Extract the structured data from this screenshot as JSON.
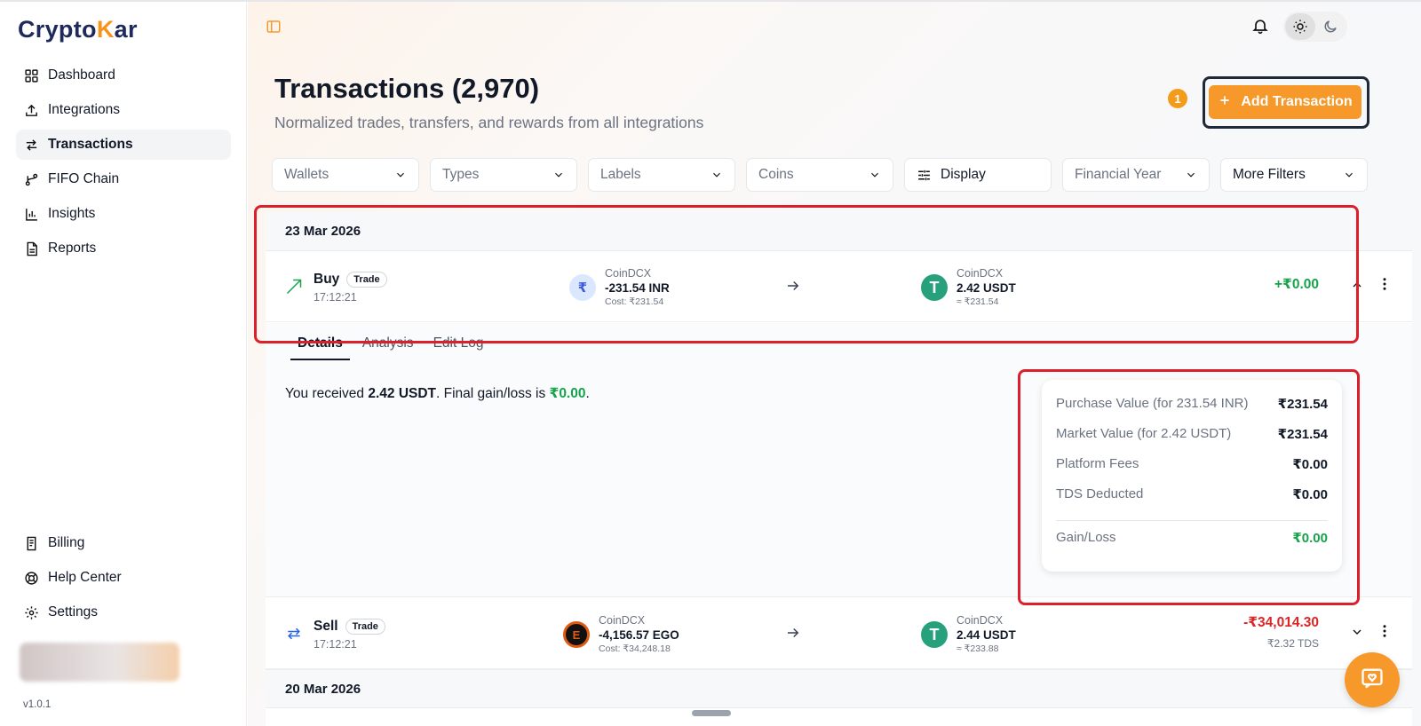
{
  "app": {
    "logo_prefix": "Crypto",
    "logo_k": "K",
    "logo_suffix": "ar",
    "version": "v1.0.1"
  },
  "sidebar": {
    "items": [
      {
        "label": "Dashboard",
        "icon": "grid-icon"
      },
      {
        "label": "Integrations",
        "icon": "upload-icon"
      },
      {
        "label": "Transactions",
        "icon": "swap-icon",
        "active": true
      },
      {
        "label": "FIFO Chain",
        "icon": "git-branch-icon"
      },
      {
        "label": "Insights",
        "icon": "bar-chart-icon"
      },
      {
        "label": "Reports",
        "icon": "document-icon"
      }
    ],
    "bottom_items": [
      {
        "label": "Billing",
        "icon": "receipt-icon"
      },
      {
        "label": "Help Center",
        "icon": "lifebuoy-icon"
      },
      {
        "label": "Settings",
        "icon": "gear-icon"
      }
    ]
  },
  "header": {
    "title": "Transactions (2,970)",
    "subtitle": "Normalized trades, transfers, and rewards from all integrations",
    "step_badge": "1",
    "add_button": "Add Transaction"
  },
  "filters": [
    {
      "label": "Wallets"
    },
    {
      "label": "Types"
    },
    {
      "label": "Labels"
    },
    {
      "label": "Coins"
    },
    {
      "label": "Display"
    },
    {
      "label": "Financial Year"
    },
    {
      "label": "More Filters"
    }
  ],
  "groups": [
    {
      "date": "23 Mar 2026",
      "transactions": [
        {
          "type": "Buy",
          "tag": "Trade",
          "time": "17:12:21",
          "from": {
            "exchange": "CoinDCX",
            "amount": "-231.54 INR",
            "sub": "Cost: ₹231.54",
            "coin_symbol": "₹"
          },
          "to": {
            "exchange": "CoinDCX",
            "amount": "2.42 USDT",
            "sub": "≈ ₹231.54",
            "coin_symbol": "T"
          },
          "gain": "+₹0.00",
          "expanded": {
            "tabs": [
              "Details",
              "Analysis",
              "Edit Log"
            ],
            "summary_prefix": "You received ",
            "summary_amount": "2.42 USDT",
            "summary_mid": ". Final gain/loss is ",
            "summary_gain": "₹0.00",
            "summary_end": ".",
            "card": [
              {
                "label": "Purchase Value (for 231.54 INR)",
                "value": "₹231.54"
              },
              {
                "label": "Market Value (for 2.42 USDT)",
                "value": "₹231.54"
              },
              {
                "label": "Platform Fees",
                "value": "₹0.00"
              },
              {
                "label": "TDS Deducted",
                "value": "₹0.00"
              }
            ],
            "gain_label": "Gain/Loss",
            "gain_value": "₹0.00"
          }
        },
        {
          "type": "Sell",
          "tag": "Trade",
          "time": "17:12:21",
          "from": {
            "exchange": "CoinDCX",
            "amount": "-4,156.57 EGO",
            "sub": "Cost: ₹34,248.18",
            "coin_symbol": "E"
          },
          "to": {
            "exchange": "CoinDCX",
            "amount": "2.44 USDT",
            "sub": "≈ ₹233.88",
            "coin_symbol": "T"
          },
          "gain": "-₹34,014.30",
          "gain_sub": "₹2.32 TDS"
        }
      ]
    },
    {
      "date": "20 Mar 2026"
    }
  ],
  "colors": {
    "accent": "#f7992a",
    "green": "#16a34a",
    "red": "#dc2626",
    "annotation": "#dc1f2a"
  }
}
